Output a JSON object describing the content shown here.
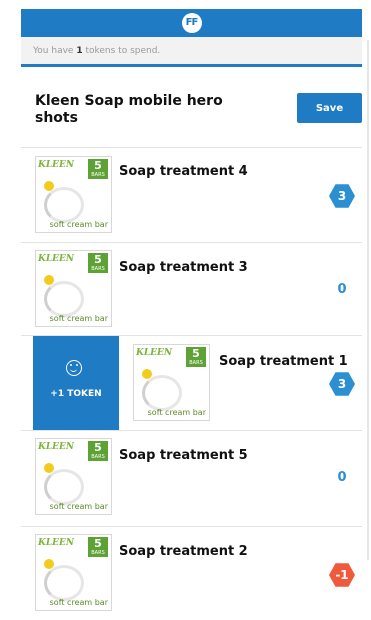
{
  "header": {
    "logo_text": "FF"
  },
  "token_bar": {
    "prefix": "You have ",
    "count": "1",
    "suffix": " tokens to spend.",
    "progress": 1.0,
    "accent": "#1f7bc4"
  },
  "project": {
    "title": "Kleen Soap mobile hero shots",
    "save_label": "Save"
  },
  "swipe_action": {
    "label": "+1 TOKEN",
    "icon": "smiley-icon"
  },
  "items": [
    {
      "name": "Soap treatment 4",
      "count": "3",
      "count_style": "hex",
      "thumb": {
        "brand": "KLEEN",
        "pack": "5",
        "pack_sub": "BARS",
        "caption": "soft cream bar"
      }
    },
    {
      "name": "Soap treatment 3",
      "count": "0",
      "count_style": "plain",
      "thumb": {
        "brand": "KLEEN",
        "pack": "5",
        "pack_sub": "BARS",
        "caption": "soft cream bar"
      }
    },
    {
      "name": "Soap treatment 1",
      "count": "3",
      "count_style": "hex",
      "thumb": {
        "brand": "KLEEN",
        "pack": "5",
        "pack_sub": "BARS",
        "caption": "soft cream bar"
      }
    },
    {
      "name": "Soap treatment 5",
      "count": "0",
      "count_style": "plain",
      "thumb": {
        "brand": "KLEEN",
        "pack": "5",
        "pack_sub": "BARS",
        "caption": "soft cream bar"
      }
    },
    {
      "name": "Soap treatment 2",
      "count": "-1",
      "count_style": "neg",
      "thumb": {
        "brand": "KLEEN",
        "pack": "5",
        "pack_sub": "BARS",
        "caption": "soft cream bar"
      }
    }
  ]
}
